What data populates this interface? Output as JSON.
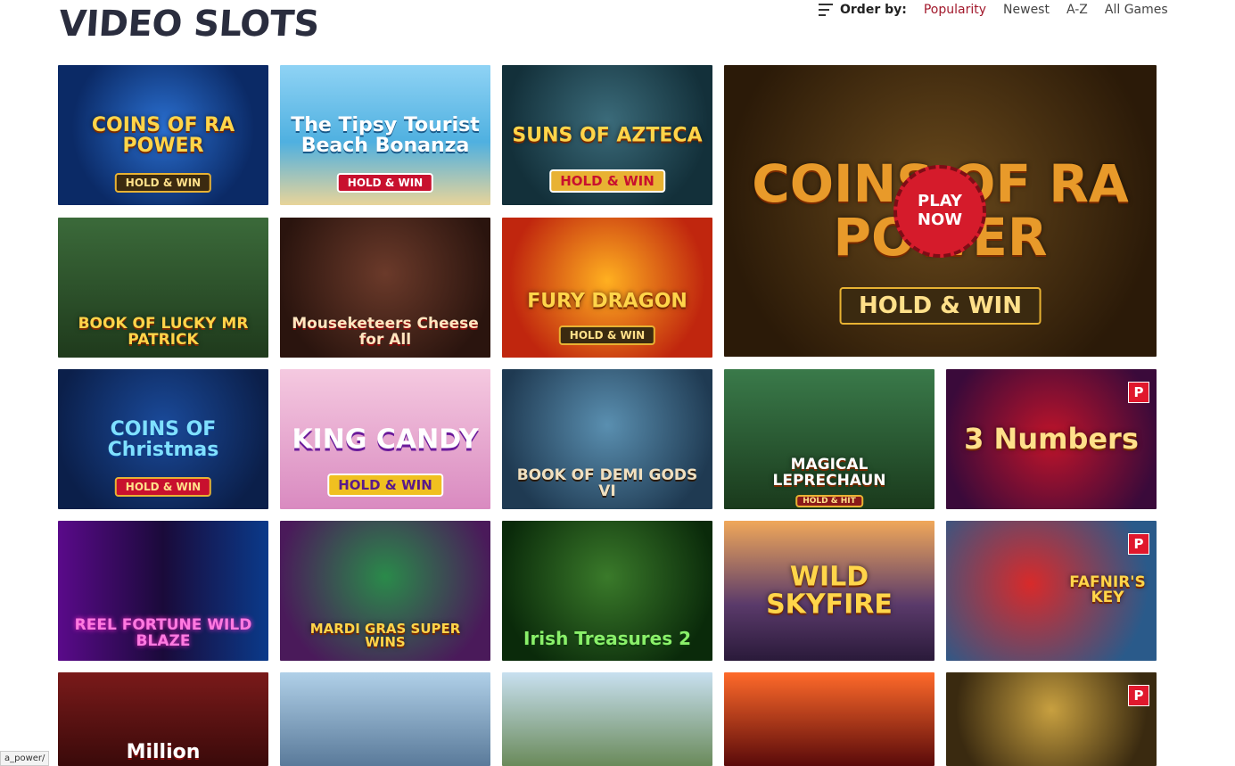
{
  "page": {
    "title": "VIDEO SLOTS",
    "order_by_label": "Order by:",
    "sort_options": [
      "Popularity",
      "Newest",
      "A-Z",
      "All Games"
    ],
    "active_sort": "Popularity",
    "status_url": "a_power/"
  },
  "featured": {
    "title": "COINS OF RA POWER",
    "subtitle": "HOLD & WIN",
    "play_label": "PLAY NOW"
  },
  "games": [
    {
      "title": "COINS OF RA POWER",
      "subtitle": "HOLD & WIN"
    },
    {
      "title": "The Tipsy Tourist Beach Bonanza",
      "subtitle": "HOLD & WIN"
    },
    {
      "title": "SUNS OF AZTECA",
      "subtitle": "HOLD & WIN"
    },
    {
      "title": "BOOK OF LUCKY MR PATRICK",
      "subtitle": ""
    },
    {
      "title": "Mouseketeers Cheese for All",
      "subtitle": ""
    },
    {
      "title": "FURY DRAGON",
      "subtitle": "HOLD & WIN"
    },
    {
      "title": "COINS OF Christmas",
      "subtitle": "HOLD & WIN"
    },
    {
      "title": "KING CANDY",
      "subtitle": "HOLD & WIN"
    },
    {
      "title": "BOOK OF DEMI GODS VI",
      "subtitle": ""
    },
    {
      "title": "MAGICAL LEPRECHAUN",
      "subtitle": "HOLD & HIT"
    },
    {
      "title": "3 Numbers",
      "subtitle": "",
      "badge": "P"
    },
    {
      "title": "REEL FORTUNE WILD BLAZE",
      "subtitle": ""
    },
    {
      "title": "MARDI GRAS SUPER WINS",
      "subtitle": ""
    },
    {
      "title": "Irish Treasures 2",
      "subtitle": ""
    },
    {
      "title": "WILD SKYFIRE",
      "subtitle": ""
    },
    {
      "title": "FAFNIR'S KEY",
      "subtitle": "",
      "badge": "P"
    },
    {
      "title": "Million",
      "subtitle": ""
    },
    {
      "title": "",
      "subtitle": ""
    },
    {
      "title": "",
      "subtitle": ""
    },
    {
      "title": "",
      "subtitle": ""
    },
    {
      "title": "",
      "subtitle": "",
      "badge": "P"
    }
  ]
}
